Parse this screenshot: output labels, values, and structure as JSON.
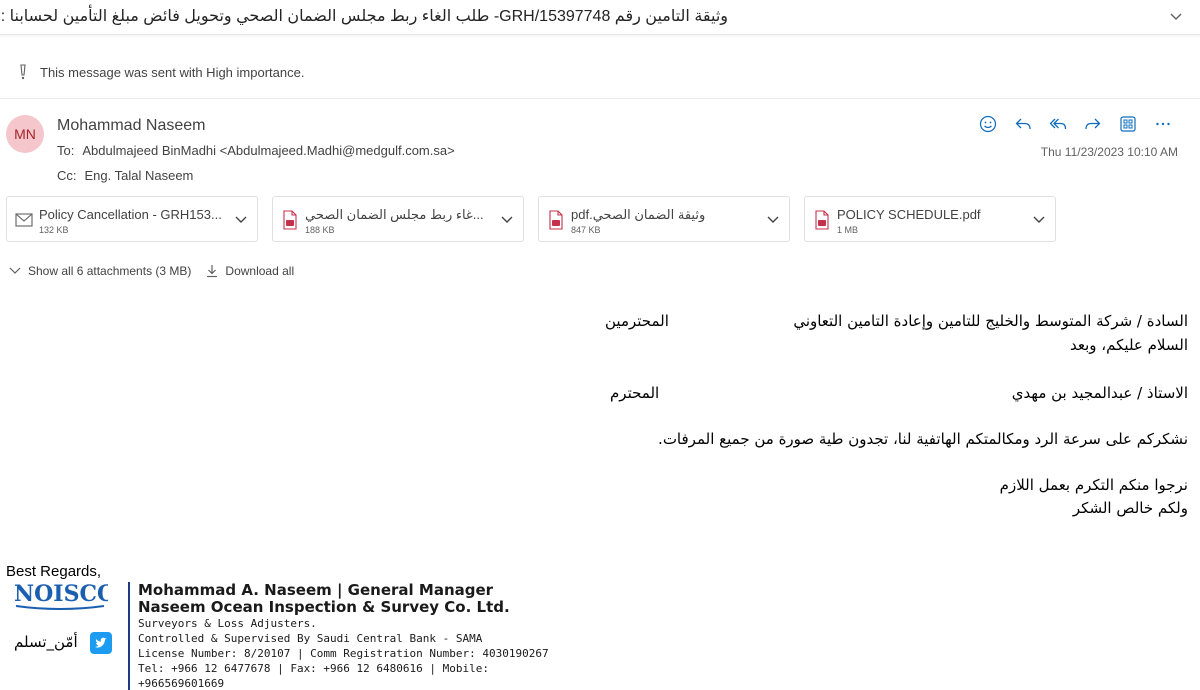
{
  "subject": "Re: طلب الغاء ربط مجلس الضمان الصحي وتحويل فائض مبلغ التأمين لحسابنا -GRH/15397748 وثيقة التامين رقم",
  "importance_message": "This message was sent with High importance.",
  "sender": {
    "initials": "MN",
    "name": "Mohammad Naseem",
    "to_label": "To:",
    "to_value": "Abdulmajeed BinMadhi <Abdulmajeed.Madhi@medgulf.com.sa>",
    "cc_label": "Cc:",
    "cc_value": "Eng. Talal Naseem",
    "timestamp": "Thu 11/23/2023 10:10 AM"
  },
  "actions": [
    "smiley-icon",
    "reply-icon",
    "reply-all-icon",
    "forward-icon",
    "apps-icon",
    "more-icon"
  ],
  "attachments": [
    {
      "name": "Policy Cancellation - GRH153...",
      "size": "132 KB",
      "icon": "email-file-icon"
    },
    {
      "name": "...غاء ربط مجلس الضمان الصحي",
      "size": "188 KB",
      "icon": "pdf-file-icon"
    },
    {
      "name": "وثيقة الضمان الصحي.pdf",
      "size": "847 KB",
      "icon": "pdf-file-icon"
    },
    {
      "name": "POLICY SCHEDULE.pdf",
      "size": "1 MB",
      "icon": "pdf-file-icon"
    }
  ],
  "attachment_links": {
    "show_all": "Show all 6 attachments (3 MB)",
    "download_all": "Download all"
  },
  "body": {
    "line1_main": "السادة / شركة المتوسط والخليج للتامين وإعادة التامين التعاوني",
    "line1_suffix": "المحترمين",
    "line2": "السلام عليكم، وبعد",
    "line3_main": "الاستاذ / عبدالمجيد بن مهدي",
    "line3_suffix": "المحترم",
    "line4": "نشكركم على سرعة الرد ومكالمتكم الهاتفية لنا،  تجدون طية صورة من جميع المرفات.",
    "line5": "نرجوا منكم التكرم بعمل اللازم",
    "line6": "ولكم خالص الشكر"
  },
  "signature": {
    "greeting": "Best Regards,",
    "logo_text": "NOISCO",
    "twitter_handle": "أمّن_تسلم",
    "name_title": "Mohammad A. Naseem | General Manager",
    "company": "Naseem Ocean Inspection & Survey Co. Ltd.",
    "line1": "Surveyors & Loss Adjusters.",
    "line2": "Controlled & Supervised By Saudi Central Bank - SAMA",
    "line3": "License Number: 8/20107 | Comm Registration Number: 4030190267",
    "line4": "Tel: +966 12 6477678 | Fax: +966 12 6480616 | Mobile:",
    "line5": "+966569601669"
  },
  "colors": {
    "accent": "#0f6cbd",
    "avatar_bg": "#f5c6cb",
    "avatar_text": "#a4262c",
    "pdf_red": "#c4314b",
    "logo_blue": "#1b5fb0",
    "twitter_blue": "#1d9bf0"
  }
}
